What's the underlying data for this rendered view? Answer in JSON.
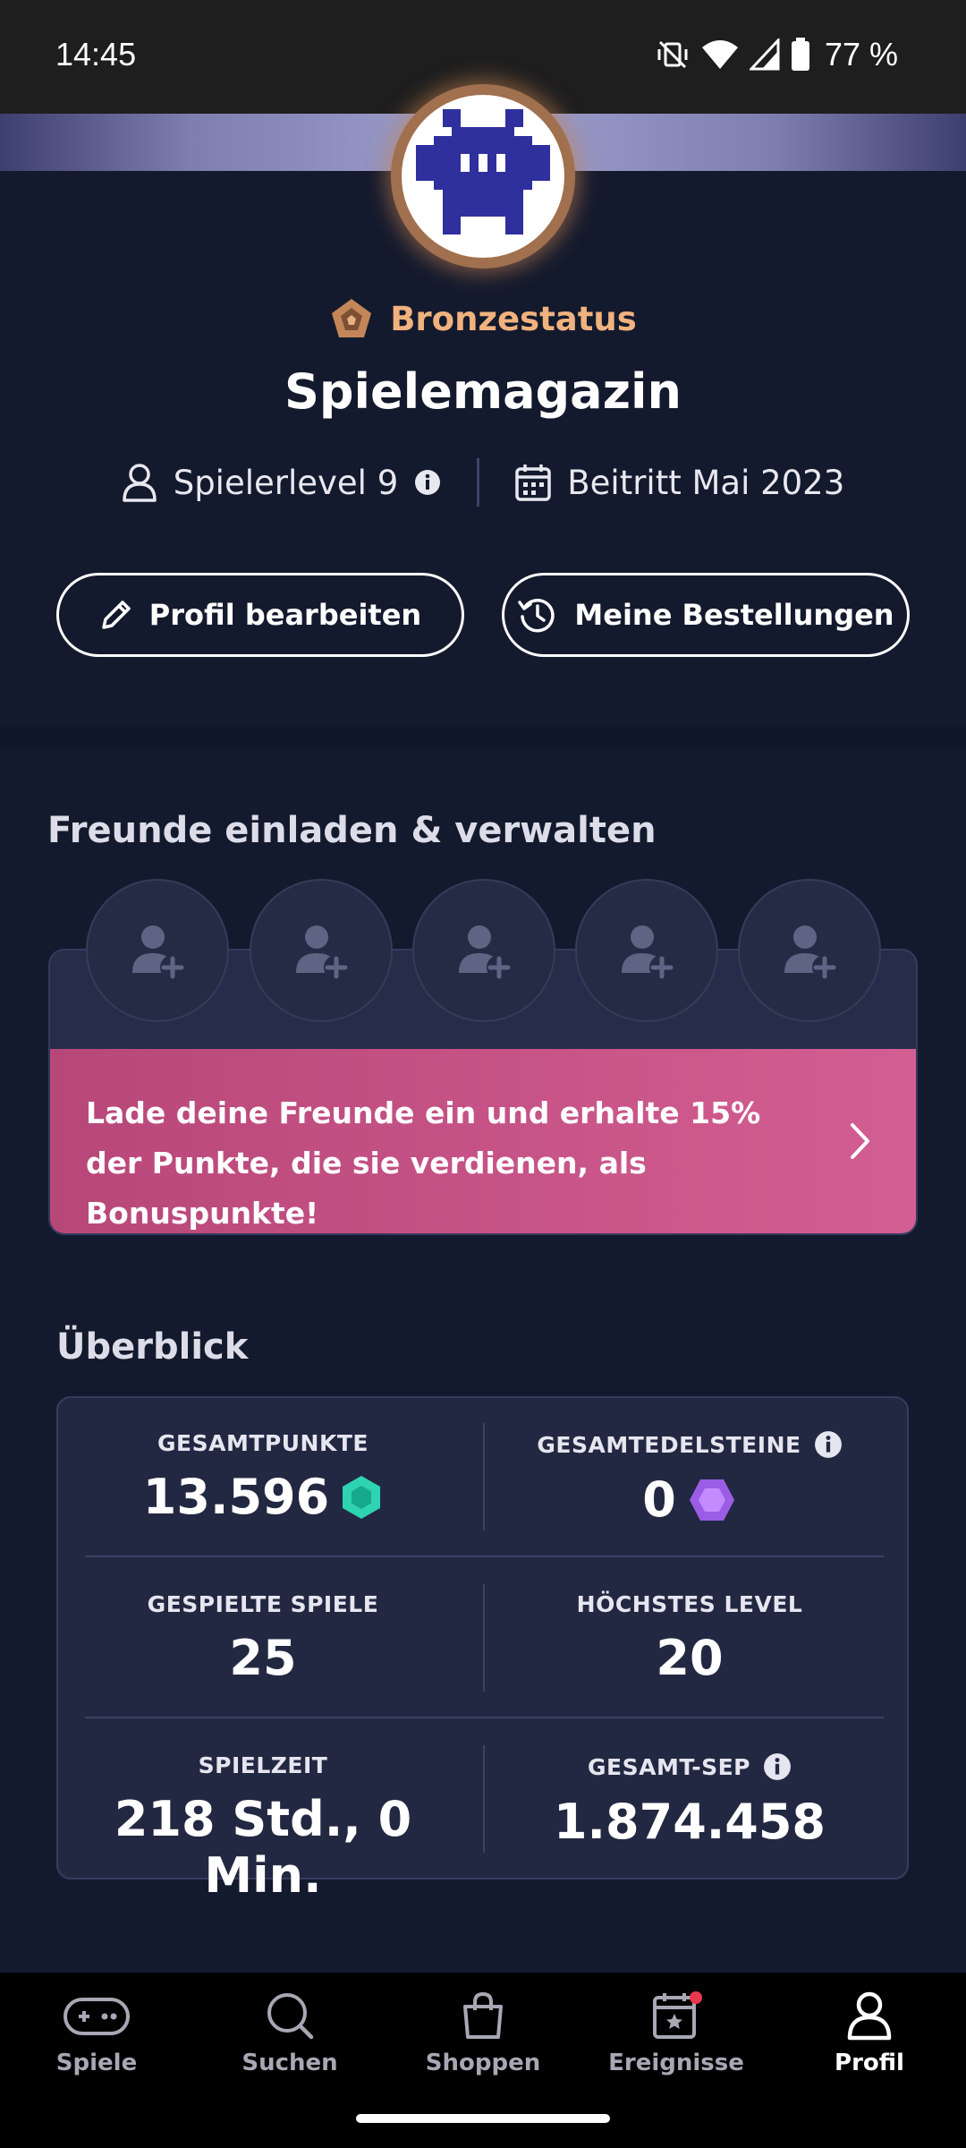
{
  "status_bar": {
    "time": "14:45",
    "battery": "77 %"
  },
  "profile": {
    "status": "Bronzestatus",
    "username": "Spielemagazin",
    "level": "Spielerlevel 9",
    "joined": "Beitritt Mai 2023",
    "edit_button": "Profil bearbeiten",
    "orders_button": "Meine Bestellungen"
  },
  "friends": {
    "title": "Freunde einladen & verwalten",
    "invite_text": "Lade deine Freunde ein und erhalte 15% der Punkte, die sie verdienen, als Bonuspunkte!"
  },
  "overview": {
    "title": "Überblick",
    "stats": [
      {
        "label": "GESAMTPUNKTE",
        "value": "13.596"
      },
      {
        "label": "GESAMTEDELSTEINE",
        "value": "0"
      },
      {
        "label": "GESPIELTE SPIELE",
        "value": "25"
      },
      {
        "label": "HÖCHSTES LEVEL",
        "value": "20"
      },
      {
        "label": "SPIELZEIT",
        "value": "218 Std., 0 Min."
      },
      {
        "label": "GESAMT-SEP",
        "value": "1.874.458"
      }
    ]
  },
  "nav": {
    "items": [
      {
        "label": "Spiele",
        "icon": "gamepad-icon"
      },
      {
        "label": "Suchen",
        "icon": "search-icon"
      },
      {
        "label": "Shoppen",
        "icon": "shopping-bag-icon"
      },
      {
        "label": "Ereignisse",
        "icon": "calendar-star-icon"
      },
      {
        "label": "Profil",
        "icon": "profile-icon"
      }
    ]
  },
  "colors": {
    "background": "#141a2d",
    "bronze": "#f0b27e",
    "invite_pink": "#d35e93",
    "points_teal": "#2ed3b1",
    "gem_purple": "#9b5de5",
    "avatar_blue": "#2f2f9e"
  }
}
